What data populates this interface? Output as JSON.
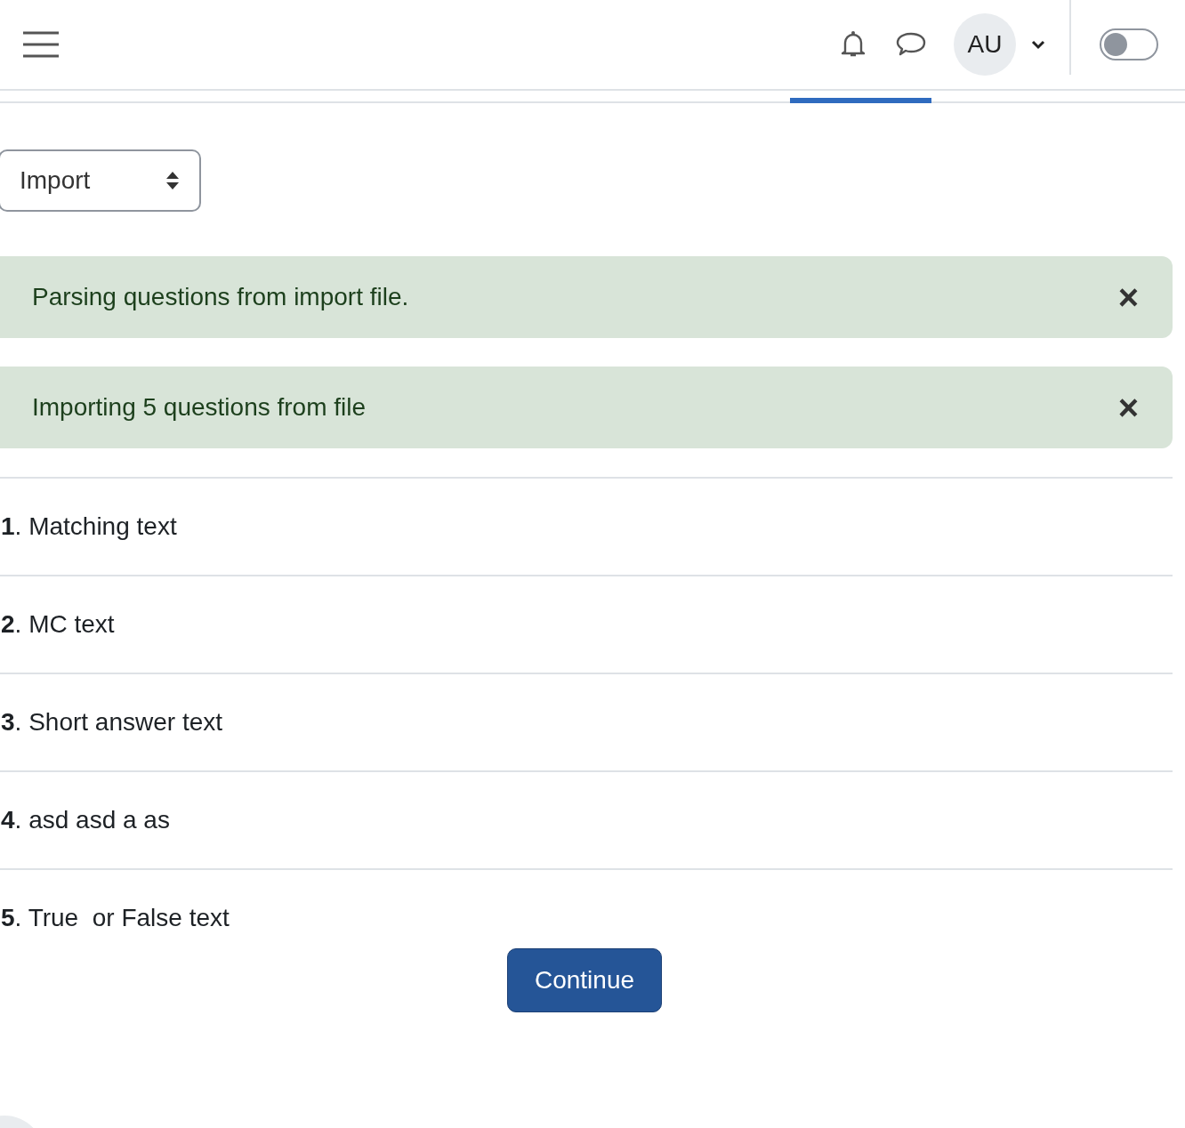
{
  "navbar": {
    "avatar": "AU",
    "edit_mode": {
      "on": false
    }
  },
  "select": {
    "value": "Import"
  },
  "alerts": [
    {
      "text": "Parsing questions from import file.",
      "close": "×"
    },
    {
      "text": "Importing 5 questions from file",
      "close": "×"
    }
  ],
  "questions": [
    {
      "number": "1",
      "text": ". Matching text"
    },
    {
      "number": "2",
      "text": ". MC text"
    },
    {
      "number": "3",
      "text": ". Short answer text"
    },
    {
      "number": "4",
      "text": ". asd asd a as"
    },
    {
      "number": "5",
      "text": ". True  or False text"
    }
  ],
  "continue_button": "Continue"
}
